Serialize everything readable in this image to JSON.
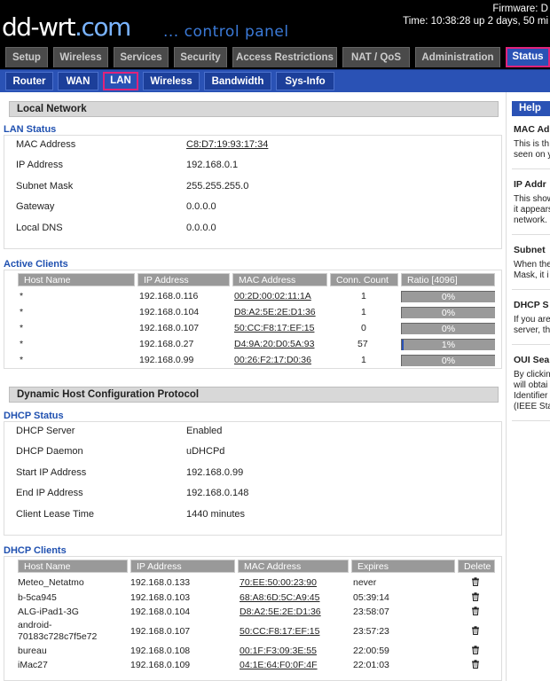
{
  "header": {
    "logo": "dd-wrt",
    "logo_dot": ".com",
    "tagline": "... control panel",
    "firmware": "Firmware: D",
    "uptime": "Time: 10:38:28 up 2 days, 50 mi"
  },
  "main_tabs": [
    "Setup",
    "Wireless",
    "Services",
    "Security",
    "Access Restrictions",
    "NAT / QoS",
    "Administration",
    "Status"
  ],
  "sub_tabs": [
    "Router",
    "WAN",
    "LAN",
    "Wireless",
    "Bandwidth",
    "Sys-Info"
  ],
  "local_network": {
    "title": "Local Network",
    "lan_status": {
      "label": "LAN Status",
      "rows": [
        {
          "k": "MAC Address",
          "v": "C8:D7:19:93:17:34"
        },
        {
          "k": "IP Address",
          "v": "192.168.0.1"
        },
        {
          "k": "Subnet Mask",
          "v": "255.255.255.0"
        },
        {
          "k": "Gateway",
          "v": "0.0.0.0"
        },
        {
          "k": "Local DNS",
          "v": "0.0.0.0"
        }
      ]
    },
    "active_clients": {
      "label": "Active Clients",
      "headers": [
        "Host Name",
        "IP Address",
        "MAC Address",
        "Conn. Count",
        "Ratio [4096]"
      ],
      "rows": [
        {
          "host": "*",
          "ip": "192.168.0.116",
          "mac": "00:2D:00:02:11:1A",
          "count": "1",
          "ratio": "0%",
          "ratio_value": 0
        },
        {
          "host": "*",
          "ip": "192.168.0.104",
          "mac": "D8:A2:5E:2E:D1:36",
          "count": "1",
          "ratio": "0%",
          "ratio_value": 0
        },
        {
          "host": "*",
          "ip": "192.168.0.107",
          "mac": "50:CC:F8:17:EF:15",
          "count": "0",
          "ratio": "0%",
          "ratio_value": 0
        },
        {
          "host": "*",
          "ip": "192.168.0.27",
          "mac": "D4:9A:20:D0:5A:93",
          "count": "57",
          "ratio": "1%",
          "ratio_value": 1
        },
        {
          "host": "*",
          "ip": "192.168.0.99",
          "mac": "00:26:F2:17:D0:36",
          "count": "1",
          "ratio": "0%",
          "ratio_value": 0
        }
      ]
    }
  },
  "dhcp": {
    "title": "Dynamic Host Configuration Protocol",
    "status": {
      "label": "DHCP Status",
      "rows": [
        {
          "k": "DHCP Server",
          "v": "Enabled"
        },
        {
          "k": "DHCP Daemon",
          "v": "uDHCPd"
        },
        {
          "k": "Start IP Address",
          "v": "192.168.0.99"
        },
        {
          "k": "End IP Address",
          "v": "192.168.0.148"
        },
        {
          "k": "Client Lease Time",
          "v": "1440 minutes"
        }
      ]
    },
    "clients": {
      "label": "DHCP Clients",
      "headers": [
        "Host Name",
        "IP Address",
        "MAC Address",
        "Expires",
        "Delete"
      ],
      "rows": [
        {
          "host": "Meteo_Netatmo",
          "ip": "192.168.0.133",
          "mac": "70:EE:50:00:23:90",
          "expires": "never"
        },
        {
          "host": "b-5ca945",
          "ip": "192.168.0.103",
          "mac": "68:A8:6D:5C:A9:45",
          "expires": "05:39:14"
        },
        {
          "host": "ALG-iPad1-3G",
          "ip": "192.168.0.104",
          "mac": "D8:A2:5E:2E:D1:36",
          "expires": "23:58:07"
        },
        {
          "host": "android-",
          "host2": "70183c728c7f5e72",
          "ip": "192.168.0.107",
          "mac": "50:CC:F8:17:EF:15",
          "expires": "23:57:23"
        },
        {
          "host": "bureau",
          "ip": "192.168.0.108",
          "mac": "00:1F:F3:09:3E:55",
          "expires": "22:00:59"
        },
        {
          "host": "iMac27",
          "ip": "192.168.0.109",
          "mac": "04:1E:64:F0:0F:4F",
          "expires": "22:01:03"
        }
      ]
    }
  },
  "help": {
    "title": "Help",
    "items": [
      {
        "t": "MAC Ad",
        "p": [
          "This is th",
          "seen on y"
        ]
      },
      {
        "t": "IP Addr",
        "p": [
          "This show",
          "it appears",
          "network."
        ]
      },
      {
        "t": "Subnet",
        "p": [
          "When the",
          "Mask, it i"
        ]
      },
      {
        "t": "DHCP S",
        "p": [
          "If you are",
          "server, th"
        ]
      },
      {
        "t": "OUI Sea",
        "p": [
          "By clickin",
          "will obtai",
          "Identifier",
          "(IEEE Sta"
        ]
      }
    ]
  },
  "colors": {
    "accent": "#2a52b5",
    "highlight": "#e0237a",
    "section_label": "#1f50b0"
  }
}
